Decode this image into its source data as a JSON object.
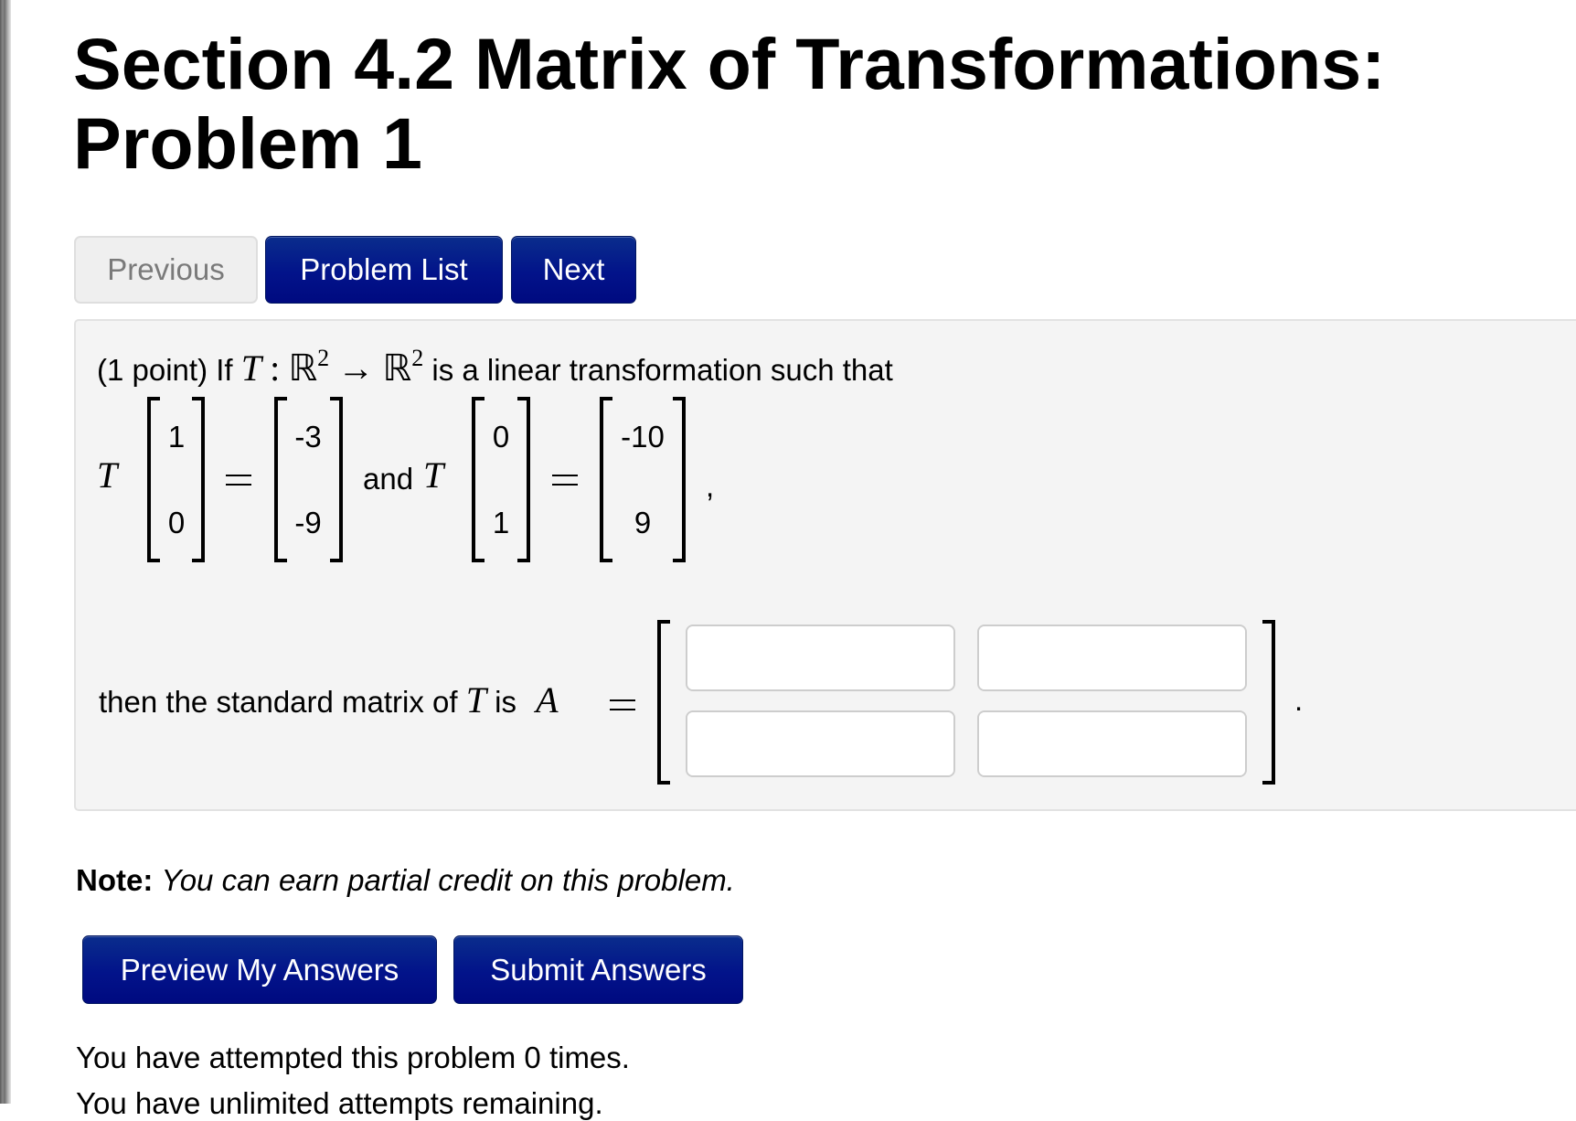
{
  "page": {
    "title_line1": "Section 4.2 Matrix of Transformations:",
    "title_line2": "Problem 1"
  },
  "nav": {
    "previous_label": "Previous",
    "previous_enabled": false,
    "problem_list_label": "Problem List",
    "next_label": "Next"
  },
  "problem": {
    "points": "(1 point) If",
    "map_symbol": "T",
    "colon": ":",
    "domain": "ℝ",
    "domain_exp": "2",
    "arrow": "→",
    "codomain": "ℝ",
    "codomain_exp": "2",
    "intro_rest": "is a linear transformation such that",
    "condition1": {
      "op": "T",
      "input": [
        "1",
        "0"
      ],
      "output": [
        "-3",
        "-9"
      ]
    },
    "joiner": "and",
    "condition2": {
      "op": "T",
      "input": [
        "0",
        "1"
      ],
      "output": [
        "-10",
        "9"
      ]
    },
    "comma": ",",
    "question_prefix": "then the standard matrix of",
    "question_T": "T",
    "question_is": "is",
    "matrix_name": "A",
    "equals": "=",
    "period": ".",
    "answer_matrix": {
      "rows": 2,
      "cols": 2,
      "values": [
        [
          "",
          ""
        ],
        [
          "",
          ""
        ]
      ],
      "placeholder": "",
      "matrix_tool_icon": "grid-icon"
    }
  },
  "note": {
    "label": "Note:",
    "text": "You can earn partial credit on this problem."
  },
  "actions": {
    "preview_label": "Preview My Answers",
    "submit_label": "Submit Answers"
  },
  "status": {
    "attempts": "You have attempted this problem 0 times.",
    "remaining": "You have unlimited attempts remaining."
  },
  "colors": {
    "button_blue": "#02138a",
    "button_disabled_bg": "#efefef",
    "problem_bg": "#f4f4f4"
  }
}
